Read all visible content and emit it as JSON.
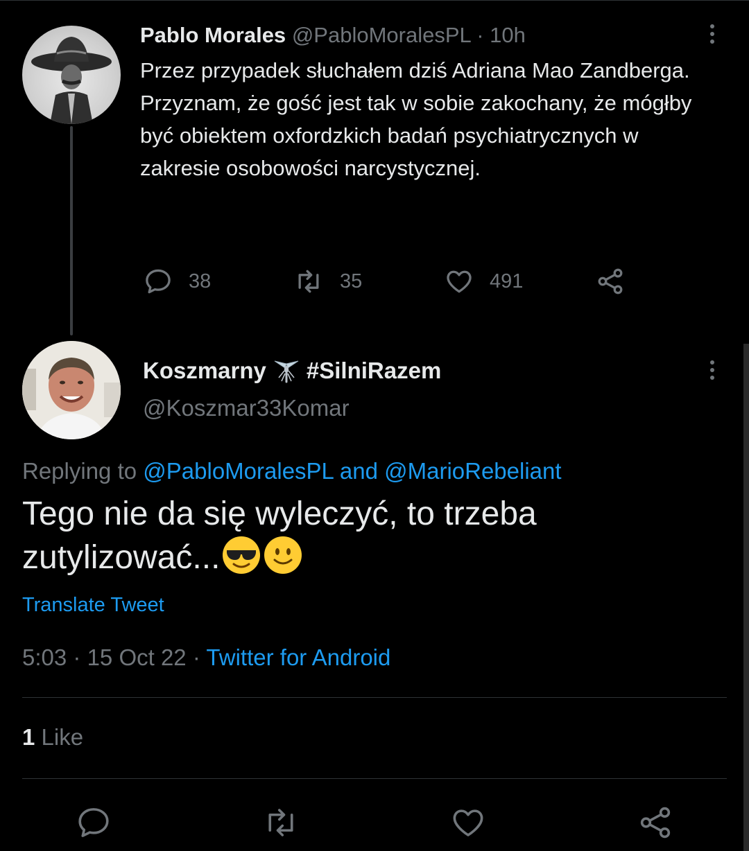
{
  "parent_tweet": {
    "author_name": "Pablo Morales",
    "author_handle": "@PabloMoralesPL",
    "separator": "·",
    "time_ago": "10h",
    "text": "Przez przypadek słuchałem dziś Adriana Mao Zandberga.\nPrzyznam, że gość jest tak w sobie zakochany, że mógłby być obiektem oxfordzkich badań psychiatrycznych w zakresie osobowości narcystycznej.",
    "reply_count": "38",
    "retweet_count": "35",
    "like_count": "491"
  },
  "reply_tweet": {
    "author_name": "Koszmarny",
    "author_name_suffix": "#SilniRazem",
    "author_handle": "@Koszmar33Komar",
    "replying_prefix": "Replying to",
    "replying_user1": "@PabloMoralesPL",
    "replying_and": "and",
    "replying_user2": "@MarioRebeliant",
    "text": "Tego nie da się wyleczyć, to trzeba zutylizować...",
    "translate_label": "Translate Tweet",
    "time": "5:03",
    "dot1": "·",
    "date": "15 Oct 22",
    "dot2": "·",
    "source": "Twitter for Android",
    "likes_count": "1",
    "likes_label": "Like"
  },
  "icons": {
    "reply": "comment-bubble-icon",
    "retweet": "retweet-icon",
    "like": "heart-icon",
    "share": "share-icon",
    "more": "more-vertical-icon",
    "mosquito": "mosquito-emoji",
    "sunglasses": "smiling-face-with-sunglasses-emoji",
    "smile": "slightly-smiling-face-emoji"
  },
  "colors": {
    "background": "#000000",
    "text": "#e7e9ea",
    "muted": "#71767b",
    "link": "#1d9bf0",
    "divider": "#2f3336"
  }
}
